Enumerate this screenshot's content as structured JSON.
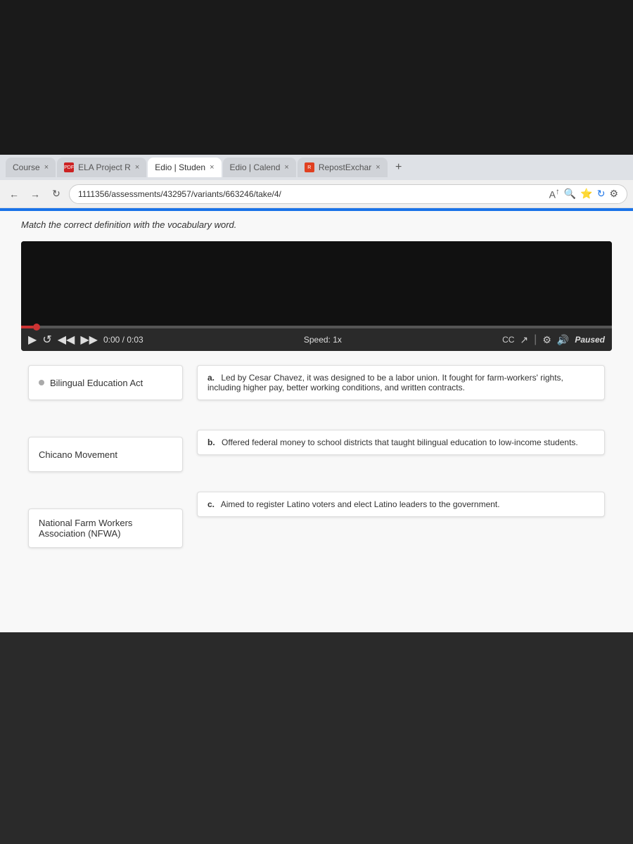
{
  "browser": {
    "tabs": [
      {
        "id": "course",
        "label": "Course",
        "active": false,
        "icon": "C"
      },
      {
        "id": "ela-project",
        "label": "ELA Project R",
        "active": false,
        "icon": "PDF"
      },
      {
        "id": "edio-student",
        "label": "Edio | Studen",
        "active": true,
        "icon": "E"
      },
      {
        "id": "edio-calendar",
        "label": "Edio | Calend",
        "active": false,
        "icon": "E"
      },
      {
        "id": "repost-exchange",
        "label": "RepostExchar",
        "active": false,
        "icon": "R"
      }
    ],
    "address": "1111356/assessments/432957/variants/663246/take/4/",
    "plus_label": "+"
  },
  "page": {
    "instruction": "Match the correct definition with the vocabulary word.",
    "video": {
      "time_current": "0:00",
      "time_total": "0:03",
      "speed_label": "Speed: 1x",
      "status_label": "Paused"
    },
    "terms": [
      {
        "id": "term-1",
        "text": "Bilingual Education Act"
      },
      {
        "id": "term-2",
        "text": "Chicano Movement"
      },
      {
        "id": "term-3",
        "text": "National Farm Workers Association (NFWA)"
      }
    ],
    "definitions": [
      {
        "id": "def-a",
        "letter": "a.",
        "text": "Led by Cesar Chavez, it was designed to be a labor union. It fought for farm-workers' rights, including higher pay, better working conditions, and written contracts."
      },
      {
        "id": "def-b",
        "letter": "b.",
        "text": "Offered federal money to school districts that taught bilingual education to low-income students."
      },
      {
        "id": "def-c",
        "letter": "c.",
        "text": "Aimed to register Latino voters and elect Latino leaders to the government."
      }
    ]
  },
  "icons": {
    "play": "▶",
    "reload": "↺",
    "rewind": "◀◀",
    "forward": "▶▶",
    "caption": "CC",
    "settings": "⚙",
    "volume": "🔊",
    "share": "↗",
    "fullscreen": "⛶",
    "back_nav": "←",
    "forward_nav": "→",
    "reload_nav": "↻",
    "close_tab": "×"
  }
}
